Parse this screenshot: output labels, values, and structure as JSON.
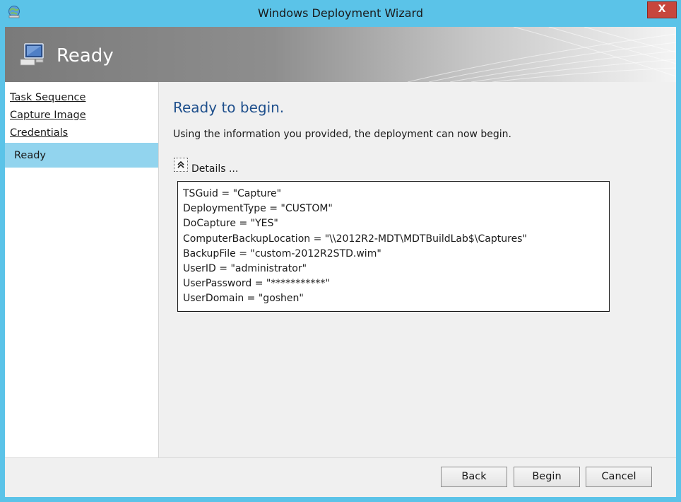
{
  "window": {
    "title": "Windows Deployment Wizard",
    "close_label": "X"
  },
  "banner": {
    "title": "Ready"
  },
  "sidebar": {
    "items": [
      {
        "label": "Task Sequence",
        "active": false
      },
      {
        "label": "Capture Image",
        "active": false
      },
      {
        "label": "Credentials",
        "active": false
      },
      {
        "label": "Ready",
        "active": true
      }
    ]
  },
  "main": {
    "heading": "Ready to begin.",
    "subtext": "Using the information you provided, the deployment can now begin.",
    "details_label": "Details ...",
    "details_lines": [
      "TSGuid = \"Capture\"",
      "DeploymentType = \"CUSTOM\"",
      "DoCapture = \"YES\"",
      "ComputerBackupLocation = \"\\\\2012R2-MDT\\MDTBuildLab$\\Captures\"",
      "BackupFile = \"custom-2012R2STD.wim\"",
      "UserID = \"administrator\"",
      "UserPassword = \"***********\"",
      "UserDomain = \"goshen\""
    ]
  },
  "footer": {
    "back_label": "Back",
    "begin_label": "Begin",
    "cancel_label": "Cancel"
  },
  "icons": {
    "app": "deployment-wizard-icon",
    "banner": "computer-monitor-icon",
    "details": "collapse-chevron-icon"
  },
  "colors": {
    "frame": "#5bc3e8",
    "active_nav": "#92d4ee",
    "heading": "#1e4f8c",
    "close": "#c7463c"
  }
}
